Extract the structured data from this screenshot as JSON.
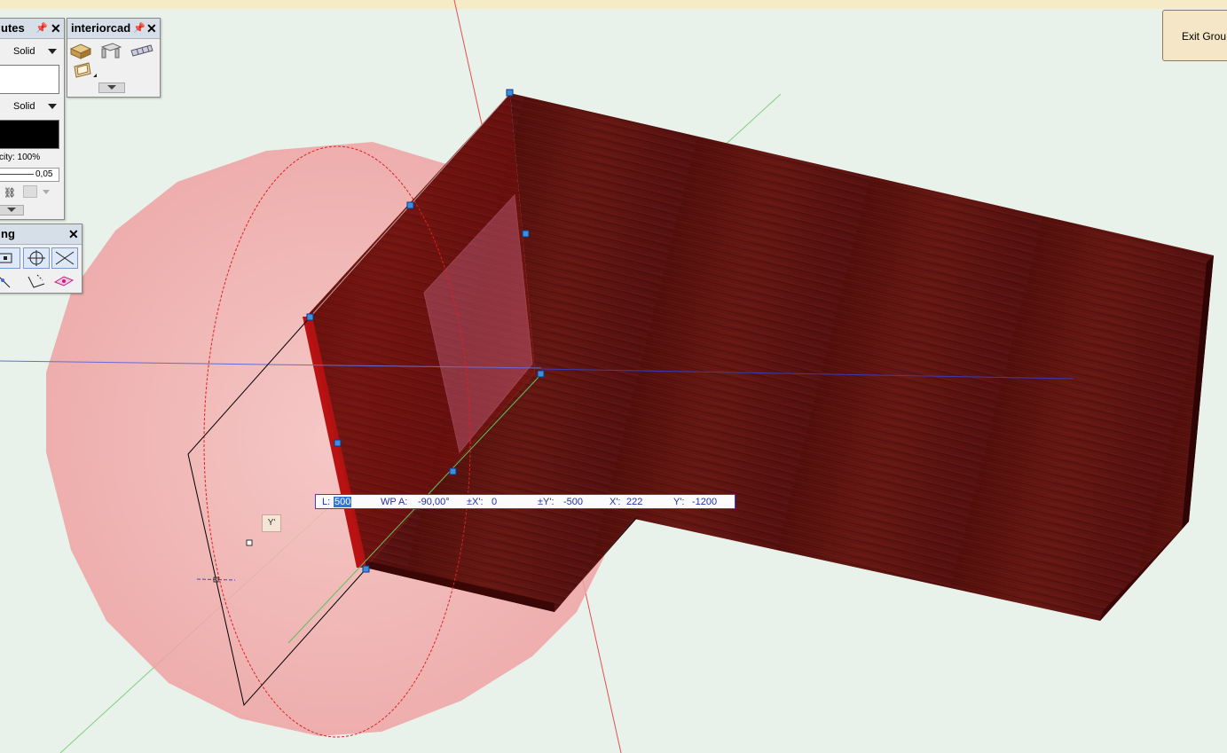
{
  "attributes_palette": {
    "title": "utes",
    "fill_style": "Solid",
    "pen_style": "Solid",
    "fill_color": "#ffffff",
    "pen_color": "#000000",
    "opacity_label": "city: 100%",
    "line_weight": "0,05"
  },
  "interiorcad_palette": {
    "title": "interiorcad",
    "tools": [
      "box-icon",
      "sofa-frame-icon",
      "grid-panel-icon",
      "frame-panel-icon"
    ]
  },
  "snapping_palette": {
    "title": "ng"
  },
  "exit_button": {
    "label": "Exit Grou"
  },
  "data_bar": {
    "l_label": "L:",
    "l_value": "500",
    "wpa_label": "WP A:",
    "wpa_value": "-90,00°",
    "dx_label": "±X':",
    "dx_value": "0",
    "dy_label": "±Y':",
    "dy_value": "-500",
    "x_label": "X':",
    "x_value": "222",
    "y_label": "Y':",
    "y_value": "-1200"
  },
  "cursor_label": "Y'",
  "colors": {
    "wood": "#5a120e",
    "wood_dark": "#3a0806",
    "sphere": "#f2a6a6",
    "handle": "#3b8fe0",
    "background": "#e9f2ea",
    "toolbar_strip": "#f5ebc6"
  }
}
